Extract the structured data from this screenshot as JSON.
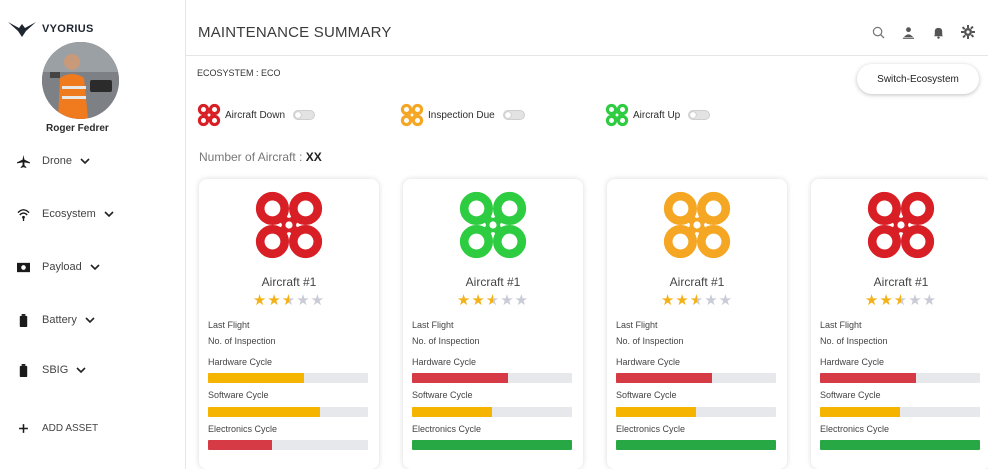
{
  "brand": {
    "name": "VYORIUS"
  },
  "user": {
    "name": "Roger Fedrer"
  },
  "sidebar": {
    "items": [
      {
        "label": "Drone",
        "icon": "airplane-icon"
      },
      {
        "label": "Ecosystem",
        "icon": "wifi-icon"
      },
      {
        "label": "Payload",
        "icon": "camera-icon"
      },
      {
        "label": "Battery",
        "icon": "battery-icon"
      },
      {
        "label": "SBIG",
        "icon": "battery-icon"
      },
      {
        "label": "ADD ASSET",
        "icon": "plus-icon"
      }
    ]
  },
  "header": {
    "title": "MAINTENANCE SUMMARY",
    "icons": [
      "search-icon",
      "user-icon",
      "bell-icon",
      "gear-icon"
    ]
  },
  "ecosystem": {
    "label": "ECOSYSTEM : ECO",
    "switch_label": "Switch-Ecosystem"
  },
  "legend": [
    {
      "label": "Aircraft Down",
      "color": "#d91f26"
    },
    {
      "label": "Inspection Due",
      "color": "#f5a623"
    },
    {
      "label": "Aircraft Up",
      "color": "#2ecc40"
    }
  ],
  "aircraft_count": {
    "label": "Number of Aircraft : ",
    "value": "XX"
  },
  "colors": {
    "yellow": "#f4b400",
    "red": "#d63a45",
    "green": "#27a845",
    "star": "#f3b21a",
    "star_off": "#c9ccd6"
  },
  "cards": [
    {
      "title": "Aircraft #1",
      "drone_color": "#d91f26",
      "rating": 2.5,
      "last_flight": "Last Flight",
      "inspections": "No. of Inspection",
      "bars": [
        {
          "label": "Hardware Cycle",
          "value": 0.6,
          "color": "#f4b400"
        },
        {
          "label": "Software Cycle",
          "value": 0.7,
          "color": "#f4b400"
        },
        {
          "label": "Electronics Cycle",
          "value": 0.4,
          "color": "#d63a45"
        }
      ]
    },
    {
      "title": "Aircraft #1",
      "drone_color": "#2ecc40",
      "rating": 2.5,
      "last_flight": "Last Flight",
      "inspections": "No. of Inspection",
      "bars": [
        {
          "label": "Hardware Cycle",
          "value": 0.6,
          "color": "#d63a45"
        },
        {
          "label": "Software Cycle",
          "value": 0.5,
          "color": "#f4b400"
        },
        {
          "label": "Electronics Cycle",
          "value": 1.0,
          "color": "#27a845"
        }
      ]
    },
    {
      "title": "Aircraft #1",
      "drone_color": "#f5a623",
      "rating": 2.5,
      "last_flight": "Last Flight",
      "inspections": "No. of Inspection",
      "bars": [
        {
          "label": "Hardware Cycle",
          "value": 0.6,
          "color": "#d63a45"
        },
        {
          "label": "Software Cycle",
          "value": 0.5,
          "color": "#f4b400"
        },
        {
          "label": "Electronics Cycle",
          "value": 1.0,
          "color": "#27a845"
        }
      ]
    },
    {
      "title": "Aircraft #1",
      "drone_color": "#d91f26",
      "rating": 2.5,
      "last_flight": "Last Flight",
      "inspections": "No. of Inspection",
      "bars": [
        {
          "label": "Hardware Cycle",
          "value": 0.6,
          "color": "#d63a45"
        },
        {
          "label": "Software Cycle",
          "value": 0.5,
          "color": "#f4b400"
        },
        {
          "label": "Electronics Cycle",
          "value": 1.0,
          "color": "#27a845"
        }
      ]
    }
  ]
}
